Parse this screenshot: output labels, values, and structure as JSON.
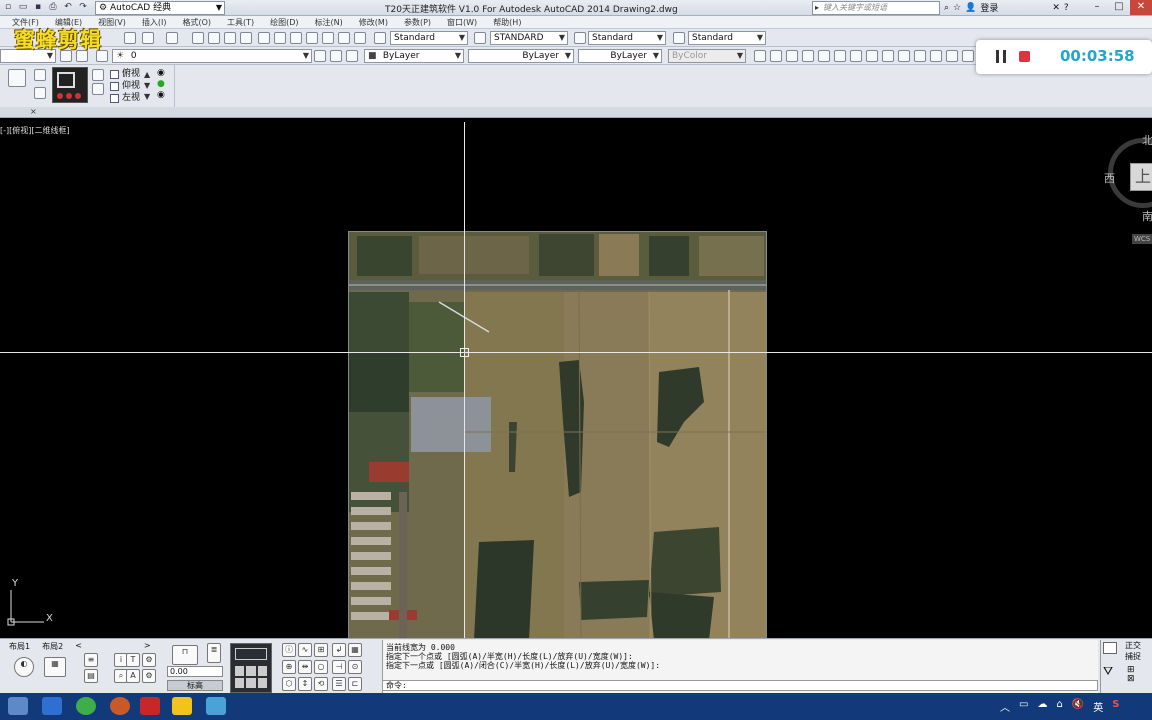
{
  "titlebar": {
    "workspace": "AutoCAD 经典",
    "title": "T20天正建筑软件 V1.0 For Autodesk AutoCAD 2014    Drawing2.dwg",
    "search_placeholder": "键入关键字或短语",
    "login": "登录"
  },
  "menu": [
    "文件(F)",
    "编辑(E)",
    "视图(V)",
    "插入(I)",
    "格式(O)",
    "工具(T)",
    "绘图(D)",
    "标注(N)",
    "修改(M)",
    "参数(P)",
    "窗口(W)",
    "帮助(H)"
  ],
  "watermark": "蜜蜂剪辑",
  "toolbar1": {
    "text_style": "Standard",
    "dim_style": "STANDARD",
    "table_style": "Standard",
    "mleader_style": "Standard"
  },
  "toolbar2": {
    "layer_value": "0",
    "color": "ByLayer",
    "linetype": "ByLayer",
    "lineweight": "ByLayer",
    "plotstyle": "ByColor"
  },
  "views": [
    "俯视",
    "仰视",
    "左视"
  ],
  "viewport_label": "[-][俯视][二维线框]",
  "viewcube": {
    "north": "北",
    "south": "南",
    "west": "西",
    "face": "上",
    "wcs": "WCS"
  },
  "ucs": {
    "x": "X",
    "y": "Y"
  },
  "recorder": {
    "time": "00:03:58"
  },
  "layout_tabs": [
    "布局1",
    "布局2",
    "<",
    ">"
  ],
  "scale_value": "0.00",
  "elevation_label": "标高",
  "command": {
    "lines": [
      "当前线宽为 0.000",
      "指定下一个点或 [圆弧(A)/半宽(H)/长度(L)/放弃(U)/宽度(W)]:",
      "指定下一点或 [圆弧(A)/闭合(C)/半宽(H)/长度(L)/放弃(U)/宽度(W)]:"
    ],
    "prompt": "命令:"
  },
  "status": [
    "正交",
    "捕捉"
  ],
  "tray": {
    "ime": "英",
    "lang_icon": "S"
  },
  "colors": {
    "recorder_time": "#22a6c9",
    "watermark": "#f2de24",
    "taskbar": "#123a7a"
  }
}
